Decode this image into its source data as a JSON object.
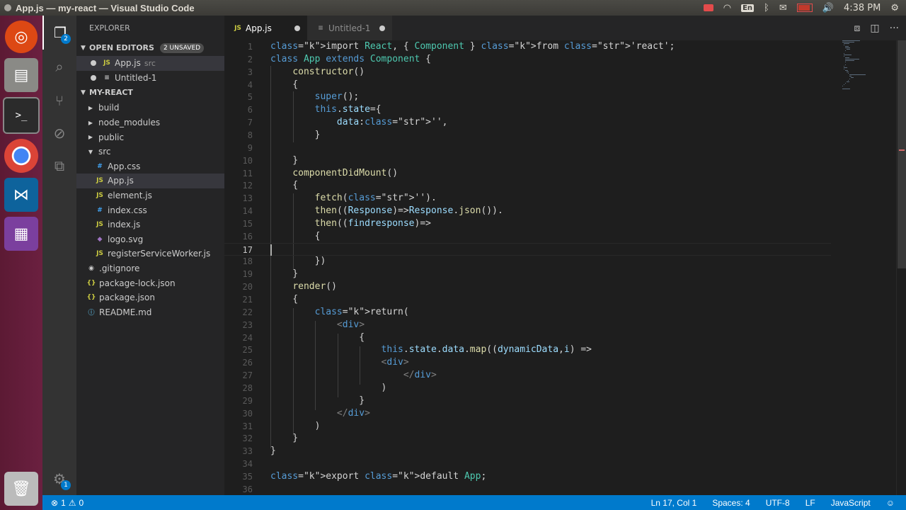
{
  "window": {
    "title": "App.js — my-react — Visual Studio Code"
  },
  "tray": {
    "lang": "En",
    "time": "4:38 PM"
  },
  "activity": {
    "explorer_badge": "2",
    "settings_badge": "1"
  },
  "sidebar": {
    "title": "EXPLORER",
    "open_editors": {
      "label": "OPEN EDITORS",
      "badge": "2 UNSAVED",
      "items": [
        {
          "icon": "JS",
          "name": "App.js",
          "desc": "src"
        },
        {
          "icon": "≡",
          "name": "Untitled-1",
          "desc": ""
        }
      ]
    },
    "project": {
      "label": "MY-REACT",
      "items": [
        {
          "type": "folder",
          "name": "build"
        },
        {
          "type": "folder",
          "name": "node_modules"
        },
        {
          "type": "folder",
          "name": "public"
        },
        {
          "type": "folder-open",
          "name": "src"
        },
        {
          "type": "css",
          "icon": "#",
          "name": "App.css"
        },
        {
          "type": "js",
          "icon": "JS",
          "name": "App.js"
        },
        {
          "type": "js",
          "icon": "JS",
          "name": "element.js"
        },
        {
          "type": "css",
          "icon": "#",
          "name": "index.css"
        },
        {
          "type": "js",
          "icon": "JS",
          "name": "index.js"
        },
        {
          "type": "svg",
          "icon": "◆",
          "name": "logo.svg"
        },
        {
          "type": "js",
          "icon": "JS",
          "name": "registerServiceWorker.js"
        },
        {
          "type": "git",
          "icon": "◉",
          "name": ".gitignore"
        },
        {
          "type": "json",
          "icon": "{}",
          "name": "package-lock.json"
        },
        {
          "type": "json",
          "icon": "{}",
          "name": "package.json"
        },
        {
          "type": "info",
          "icon": "ⓘ",
          "name": "README.md"
        }
      ]
    }
  },
  "tabs": [
    {
      "icon": "JS",
      "label": "App.js"
    },
    {
      "icon": "≡",
      "label": "Untitled-1"
    }
  ],
  "editor": {
    "current_line": 17,
    "lines": [
      "import React, { Component } from 'react';",
      "class App extends Component {",
      "    constructor()",
      "    {",
      "        super();",
      "        this.state={",
      "            data:'',",
      "        }",
      "",
      "    }",
      "    componentDidMount()",
      "    {",
      "        fetch('').",
      "        then((Response)=>Response.json()).",
      "        then((findresponse)=>",
      "        {",
      "",
      "        })",
      "    }",
      "    render()",
      "    {",
      "        return(",
      "            <div>",
      "                {",
      "                    this.state.data.map((dynamicData,i) =>",
      "                    <div>",
      "                        </div>",
      "                    )",
      "                }",
      "            </div>",
      "        )",
      "    }",
      "}",
      "",
      "export default App;",
      ""
    ]
  },
  "status": {
    "errors": "1",
    "warnings": "0",
    "position": "Ln 17, Col 1",
    "spaces": "Spaces: 4",
    "encoding": "UTF-8",
    "eol": "LF",
    "language": "JavaScript"
  },
  "colors": {
    "accent": "#007acc",
    "launcher": "#5c1a34"
  }
}
